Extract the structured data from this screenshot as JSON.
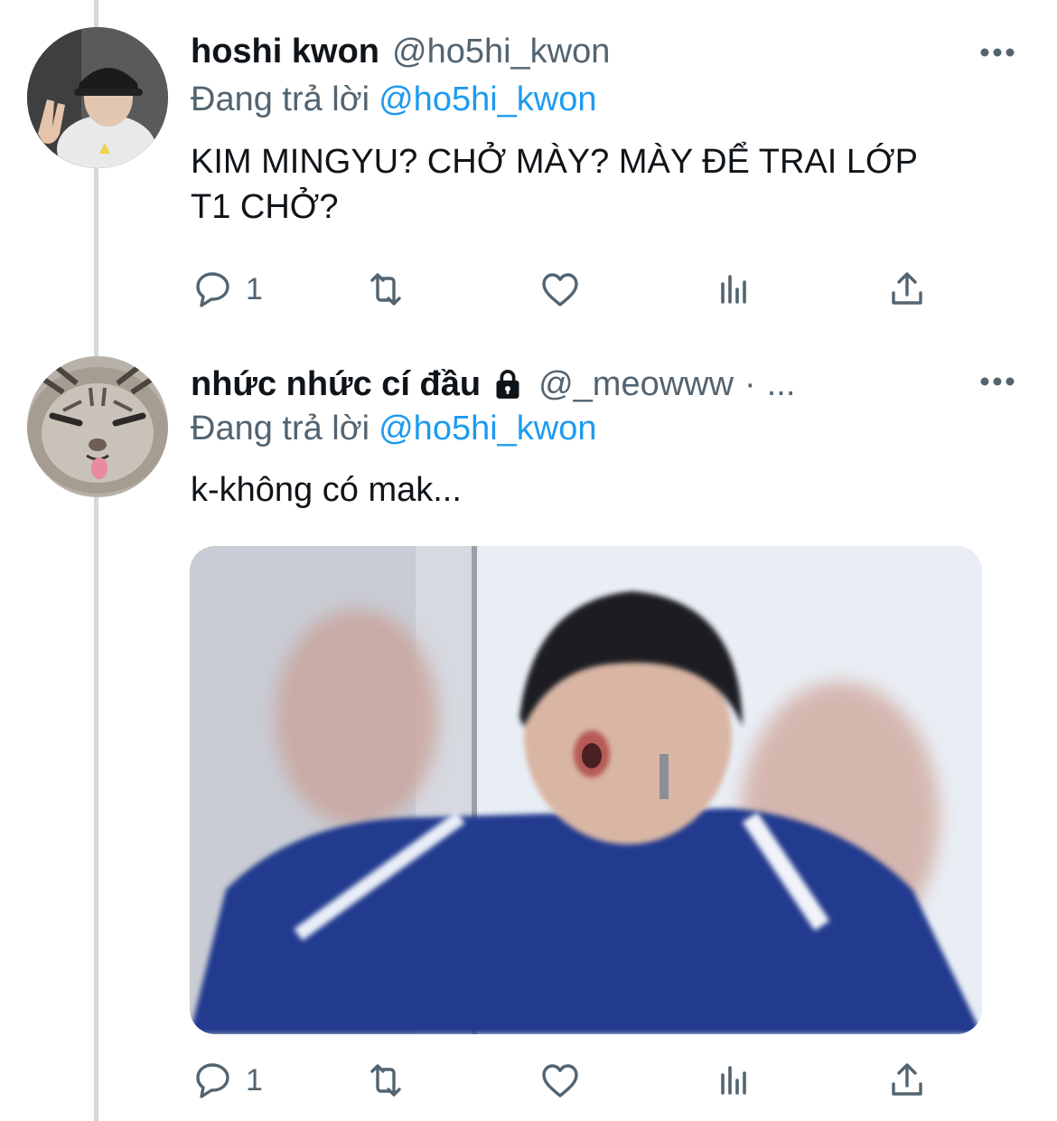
{
  "colors": {
    "text_primary": "#0f1419",
    "text_secondary": "#536471",
    "link": "#1d9bf0",
    "thread_line": "#cfd9de"
  },
  "tweets": [
    {
      "display_name": "hoshi kwon",
      "handle": "@ho5hi_kwon",
      "replying_prefix": "Đang trả lời",
      "replying_to": "@ho5hi_kwon",
      "text_line1": "KIM MINGYU? CHỞ MÀY? MÀY ĐỂ TRAI LỚP",
      "text_line2": "T1 CHỞ?",
      "reply_count": "1",
      "icons": [
        "reply-icon",
        "retweet-icon",
        "like-icon",
        "stats-icon",
        "share-icon",
        "more-icon"
      ]
    },
    {
      "display_name": "nhức nhức cí đầu",
      "handle": "@_meowww",
      "separator": "·",
      "meta_ellipsis": "...",
      "protected_icon": "lock-icon",
      "replying_prefix": "Đang trả lời",
      "replying_to": "@ho5hi_kwon",
      "text": "k-không có mak...",
      "has_media": true,
      "reply_count": "1",
      "icons": [
        "reply-icon",
        "retweet-icon",
        "like-icon",
        "stats-icon",
        "share-icon",
        "more-icon"
      ]
    }
  ]
}
